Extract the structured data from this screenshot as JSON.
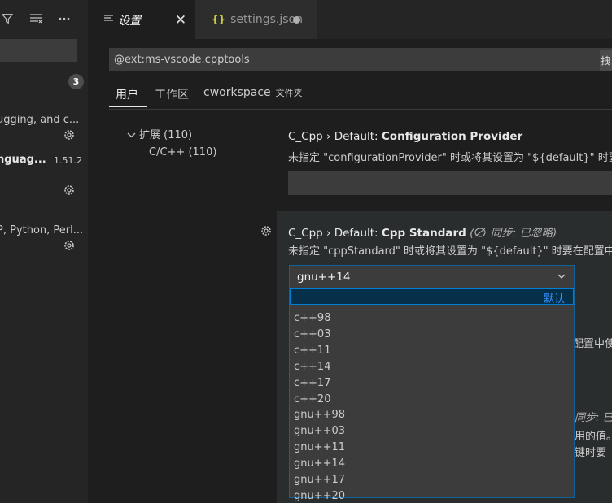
{
  "sidebar": {
    "badge": "3",
    "items": [
      {
        "label": "ugging, and c..."
      },
      {
        "label": "nguag...",
        "version": "1.51.2"
      },
      {
        "label": "P, Python, Perl..."
      }
    ]
  },
  "tabs": [
    {
      "label": "设置",
      "icon": "settings-editor-icon"
    },
    {
      "label": "settings.json",
      "icon": "json-braces-icon",
      "icon_glyph": "{}"
    }
  ],
  "search": {
    "value": "@ext:ms-vscode.cpptools",
    "right_button": "拽"
  },
  "scopes": {
    "user": "用户",
    "workspace": "工作区",
    "folder": "cworkspace",
    "folder_suffix": "文件夹"
  },
  "toc": {
    "extensions": "扩展 (110)",
    "cpp": "C/C++ (110)"
  },
  "settings": {
    "config_provider": {
      "category": "C_Cpp › Default: ",
      "name": "Configuration Provider",
      "desc": "未指定 \"configurationProvider\" 时或将其设置为 \"${default}\" 时要"
    },
    "cpp_standard": {
      "category": "C_Cpp › Default: ",
      "name": "Cpp Standard",
      "note": "同步: 已忽略",
      "desc": "未指定 \"cppStandard\" 时或将其设置为 \"${default}\" 时要在配置中",
      "value": "gnu++14",
      "default_label": "默认",
      "options": [
        "c++98",
        "c++03",
        "c++11",
        "c++14",
        "c++17",
        "c++20",
        "gnu++98",
        "gnu++03",
        "gnu++11",
        "gnu++14",
        "gnu++17",
        "gnu++20"
      ]
    }
  },
  "background_fragments": {
    "line1": "配置中使",
    "line2": "同步: 已",
    "line3": "用的值。",
    "line4": "键时要"
  },
  "colors": {
    "accent": "#007fd4",
    "focus_border": "#0e639c",
    "link": "#3794ff"
  }
}
